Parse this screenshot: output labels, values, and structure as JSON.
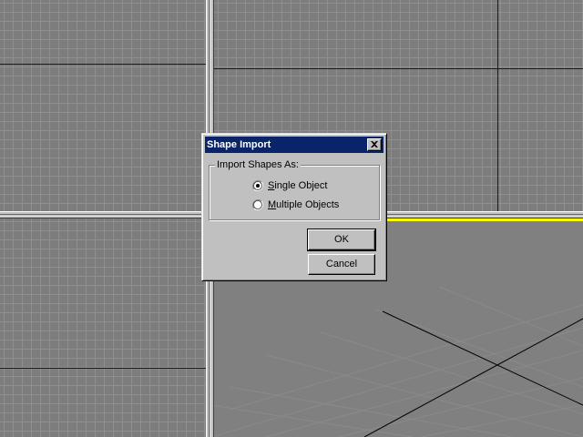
{
  "dialog": {
    "title": "Shape Import",
    "group_label": "Import Shapes As:",
    "options": [
      {
        "prefix_underline": "S",
        "rest": "ingle Object",
        "selected": true
      },
      {
        "prefix_underline": "M",
        "rest": "ultiple Objects",
        "selected": false
      }
    ],
    "ok_label": "OK",
    "cancel_label": "Cancel"
  },
  "icons": {
    "close": "close-icon",
    "radio_selected": "radio-selected-icon",
    "radio_unselected": "radio-unselected-icon"
  },
  "colors": {
    "titlebar": "#0a246a",
    "viewport_bg": "#7d7d7d",
    "grid_line": "#8f8f8f",
    "active_viewport_border": "#ffff00",
    "dialog_face": "#c0c0c0"
  }
}
